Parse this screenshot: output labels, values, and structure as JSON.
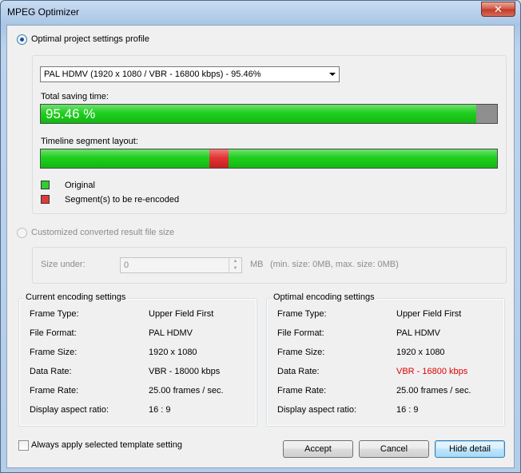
{
  "window": {
    "title": "MPEG Optimizer",
    "close_glyph": "✕"
  },
  "profile_option": {
    "label": "Optimal project settings profile",
    "selected_profile": "PAL HDMV (1920 x 1080 / VBR - 16800 kbps) - 95.46%",
    "saving_label": "Total saving time:",
    "saving_value_text": "95.46 %",
    "saving_fraction": 0.9546,
    "timeline_label": "Timeline segment layout:",
    "reencode_segment": {
      "start_fraction": 0.37,
      "end_fraction": 0.412
    },
    "legend": [
      {
        "label": "Original",
        "color": "#2ecf2e"
      },
      {
        "label": "Segment(s) to be re-encoded",
        "color": "#e23a3a"
      }
    ]
  },
  "custom_option": {
    "label": "Customized converted result file size",
    "size_label": "Size under:",
    "size_value": "0",
    "unit": "MB",
    "hint": "(min. size: 0MB, max. size: 0MB)"
  },
  "current_settings": {
    "title": "Current encoding settings",
    "rows": [
      {
        "label": "Frame Type:",
        "value": "Upper Field First"
      },
      {
        "label": "File Format:",
        "value": "PAL HDMV"
      },
      {
        "label": "Frame Size:",
        "value": "1920 x 1080"
      },
      {
        "label": "Data Rate:",
        "value": "VBR - 18000 kbps"
      },
      {
        "label": "Frame Rate:",
        "value": "25.00 frames / sec."
      },
      {
        "label": "Display aspect ratio:",
        "value": "16 : 9"
      }
    ]
  },
  "optimal_settings": {
    "title": "Optimal encoding settings",
    "rows": [
      {
        "label": "Frame Type:",
        "value": "Upper Field First"
      },
      {
        "label": "File Format:",
        "value": "PAL HDMV"
      },
      {
        "label": "Frame Size:",
        "value": "1920 x 1080"
      },
      {
        "label": "Data Rate:",
        "value": "VBR - 16800 kbps",
        "highlight": "#e00000"
      },
      {
        "label": "Frame Rate:",
        "value": "25.00 frames / sec."
      },
      {
        "label": "Display aspect ratio:",
        "value": "16 : 9"
      }
    ]
  },
  "footer": {
    "always_apply_label": "Always apply selected template setting",
    "accept_label": "Accept",
    "cancel_label": "Cancel",
    "hide_detail_label": "Hide detail"
  }
}
